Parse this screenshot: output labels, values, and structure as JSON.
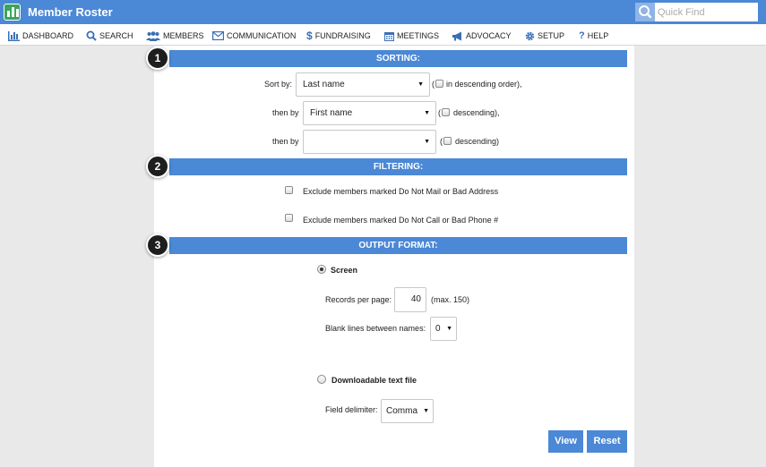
{
  "header": {
    "app_title": "Member Roster",
    "quick_find_placeholder": "Quick Find"
  },
  "nav": {
    "items": [
      {
        "label": "DASHBOARD",
        "icon": "bar-chart-icon"
      },
      {
        "label": "SEARCH",
        "icon": "search-icon"
      },
      {
        "label": "MEMBERS",
        "icon": "users-icon"
      },
      {
        "label": "COMMUNICATION",
        "icon": "envelope-icon"
      },
      {
        "label": "FUNDRAISING",
        "icon": "dollar-icon"
      },
      {
        "label": "MEETINGS",
        "icon": "calendar-icon"
      },
      {
        "label": "ADVOCACY",
        "icon": "megaphone-icon"
      },
      {
        "label": "SETUP",
        "icon": "gear-icon"
      },
      {
        "label": "HELP",
        "icon": "question-icon"
      }
    ]
  },
  "steps": [
    "1",
    "2",
    "3"
  ],
  "sorting": {
    "title": "SORTING:",
    "sort_by_label": "Sort by:",
    "sort_by_value": "Last name",
    "sort_by_desc": "in descending order),",
    "then_by_label_1": "then by",
    "then_by_value_1": "First name",
    "then_by_desc_1": "descending),",
    "then_by_label_2": "then by",
    "then_by_value_2": "",
    "then_by_desc_2": "descending)",
    "open_paren": "("
  },
  "filtering": {
    "title": "FILTERING:",
    "exclude_mail": "Exclude members marked Do Not Mail or Bad Address",
    "exclude_call": "Exclude members marked Do Not Call or Bad Phone #"
  },
  "output": {
    "title": "OUTPUT FORMAT:",
    "screen_label": "Screen",
    "records_label": "Records per page:",
    "records_value": "40",
    "records_max": "(max. 150)",
    "blank_lines_label": "Blank lines between names:",
    "blank_lines_value": "0",
    "download_label": "Downloadable text file",
    "delimiter_label": "Field delimiter:",
    "delimiter_value": "Comma"
  },
  "buttons": {
    "view": "View",
    "reset": "Reset"
  },
  "colors": {
    "accent": "#4b88d6",
    "logo": "#3aa55d"
  }
}
